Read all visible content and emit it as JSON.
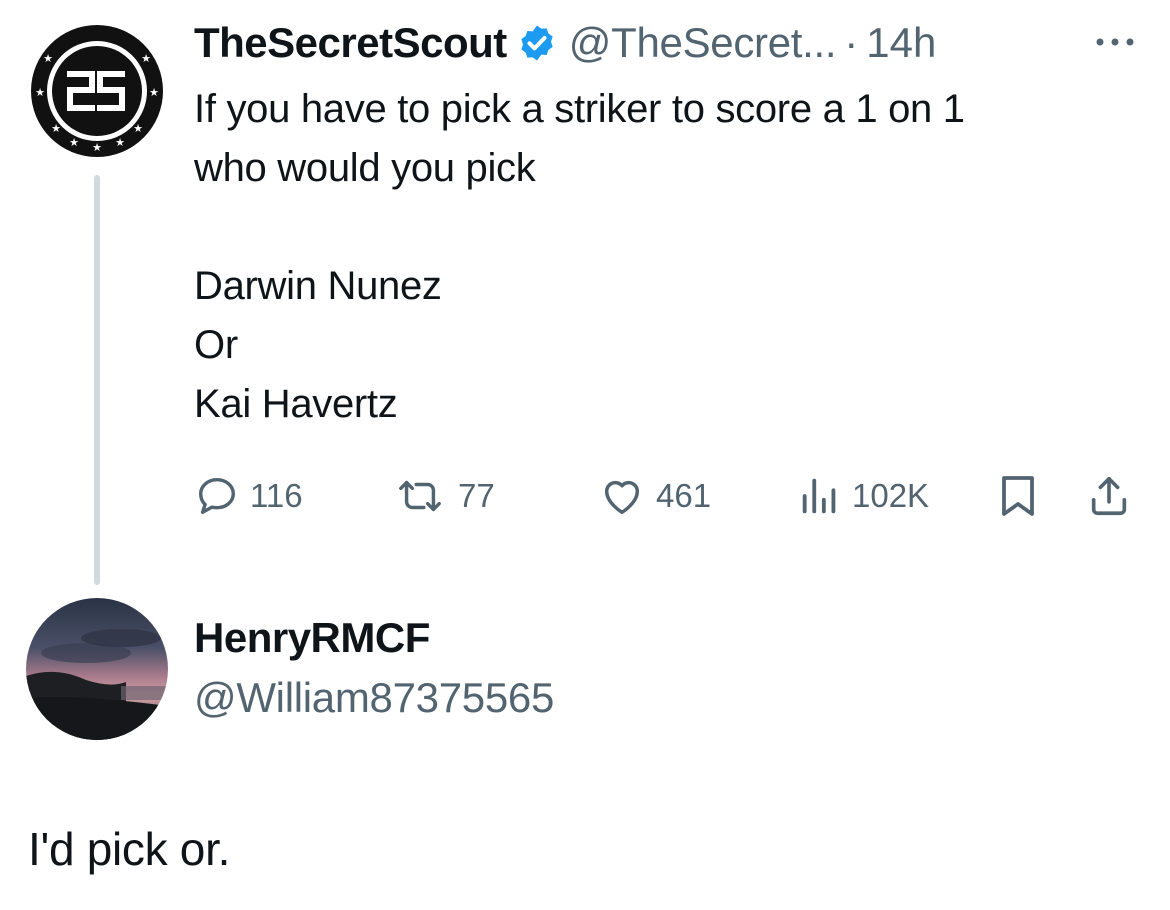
{
  "original_tweet": {
    "display_name": "TheSecretScout",
    "handle": "@TheSecret...",
    "separator": "·",
    "time": "14h",
    "text": "If you have to pick a striker to score a 1 on 1\nwho would you pick\n\nDarwin Nunez\nOr\nKai Havertz",
    "avatar_logo_text": "2S",
    "verified_icon": "verified-badge-icon",
    "more_icon": "more-dots-icon",
    "actions": {
      "replies": "116",
      "retweets": "77",
      "likes": "461",
      "views": "102K"
    }
  },
  "reply": {
    "display_name": "HenryRMCF",
    "handle": "@William87375565",
    "text": "I'd pick or.",
    "avatar": "sunset-landscape-avatar"
  },
  "colors": {
    "text_primary": "#0f1419",
    "text_secondary": "#536471",
    "verified_blue": "#1d9bf0",
    "thread_line": "#cfd9de"
  }
}
